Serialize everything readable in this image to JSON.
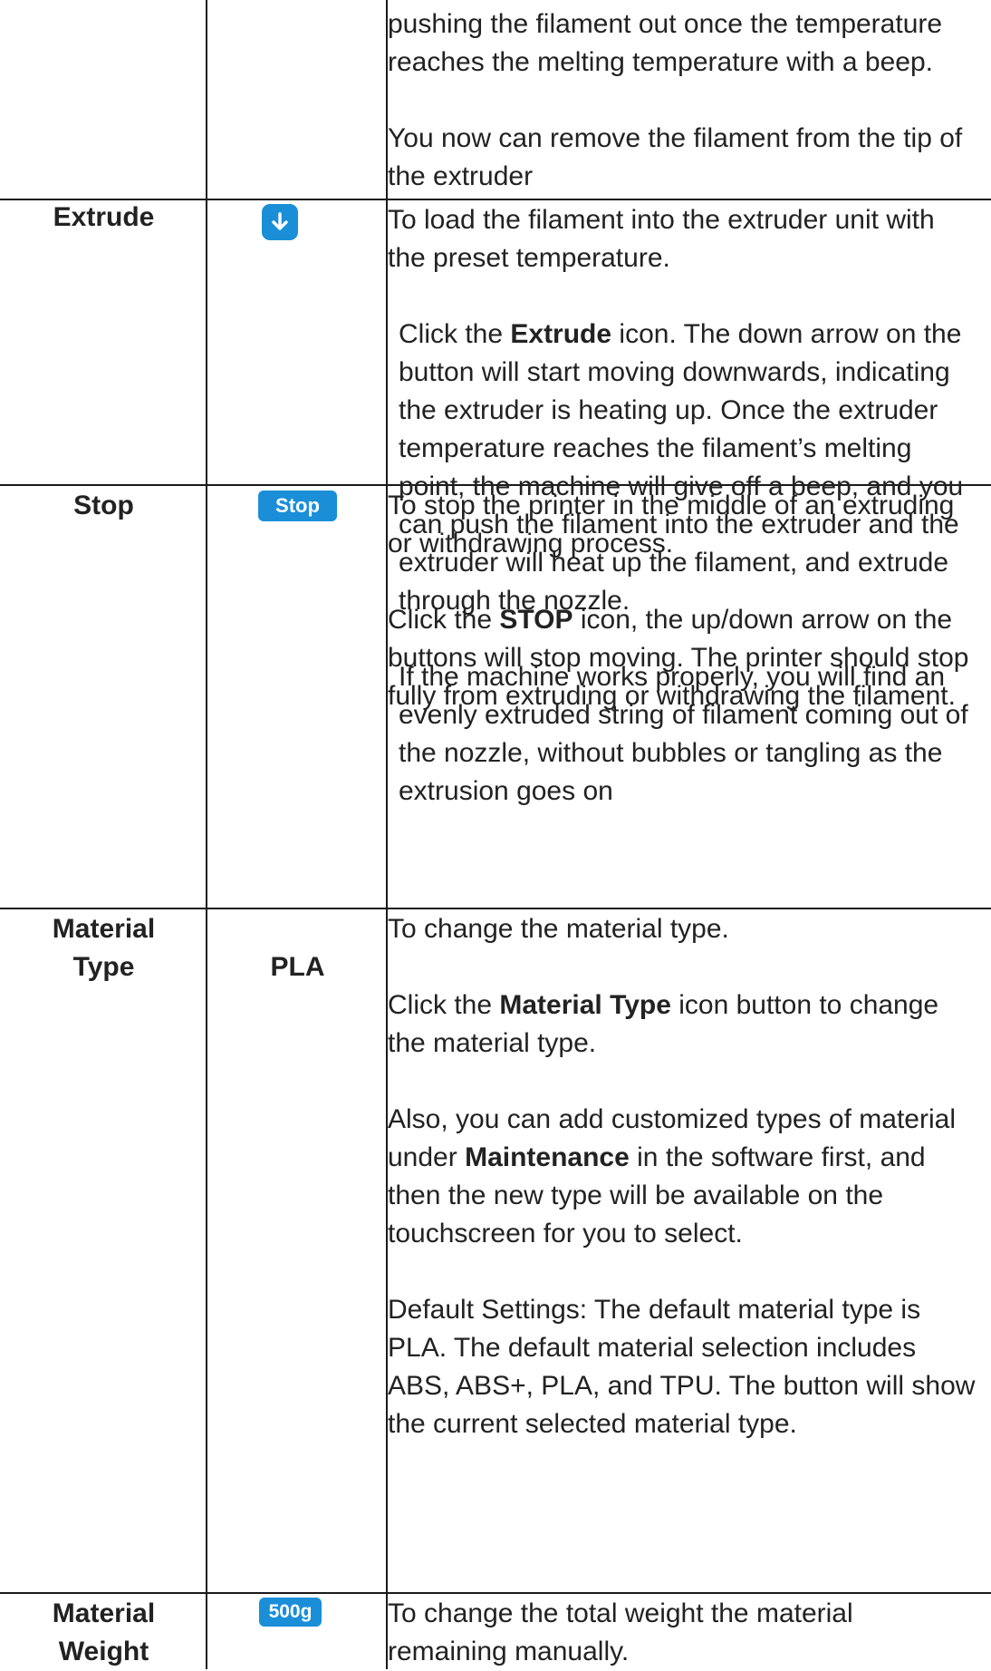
{
  "rows": [
    {
      "label_lines": [],
      "desc": {
        "p1": "pushing the filament out once the temperature reaches the melting temperature with a beep.",
        "p2": "You now can remove the filament from the tip of the extruder"
      }
    },
    {
      "label_lines": [
        "Extrude"
      ],
      "icon": "down-arrow-icon",
      "desc": {
        "p1": "To load the filament into the extruder unit with the preset temperature.",
        "p2_pre": "Click the ",
        "p2_bold": "Extrude",
        "p2_post": " icon. The down arrow on the button will start moving downwards, indicating the extruder is heating up. Once the extruder temperature reaches the filament’s melting point, the machine will give off a beep, and you can push the filament into the extruder and the extruder will heat up the filament, and extrude through the nozzle.",
        "p3": "If the machine works properly, you will find an evenly extruded string of filament coming out of the nozzle, without bubbles or tangling as the extrusion goes on"
      }
    },
    {
      "label_lines": [
        "Stop"
      ],
      "button_label": "Stop",
      "desc": {
        "p1": "To stop the printer in the middle of an extruding or withdrawing process.",
        "p2_pre": "Click the ",
        "p2_bold": "STOP",
        "p2_post": " icon, the up/down arrow on the buttons will stop moving. The printer should stop fully from extruding or withdrawing the filament."
      }
    },
    {
      "label_lines": [
        "Material",
        "Type"
      ],
      "icon_text": "PLA",
      "desc": {
        "p1": "To change the material type.",
        "p2_pre": "Click the ",
        "p2_bold": "Material Type",
        "p2_post": " icon button to change the material type.",
        "p3_pre": "Also, you can add customized types of material under ",
        "p3_bold": "Maintenance",
        "p3_post": " in the software first, and then the new type will be available on the touchscreen for you to select.",
        "p4": "Default Settings: The default material type is PLA. The default material selection includes ABS, ABS+, PLA, and TPU. The button will show the current selected material type."
      }
    },
    {
      "label_lines": [
        "Material",
        "Weight"
      ],
      "button_label": "500g",
      "desc": {
        "p1": "To change the total weight the material remaining manually."
      }
    }
  ],
  "colors": {
    "accent": "#1a8fd8",
    "text": "#222222",
    "border": "#1a1a1a"
  }
}
